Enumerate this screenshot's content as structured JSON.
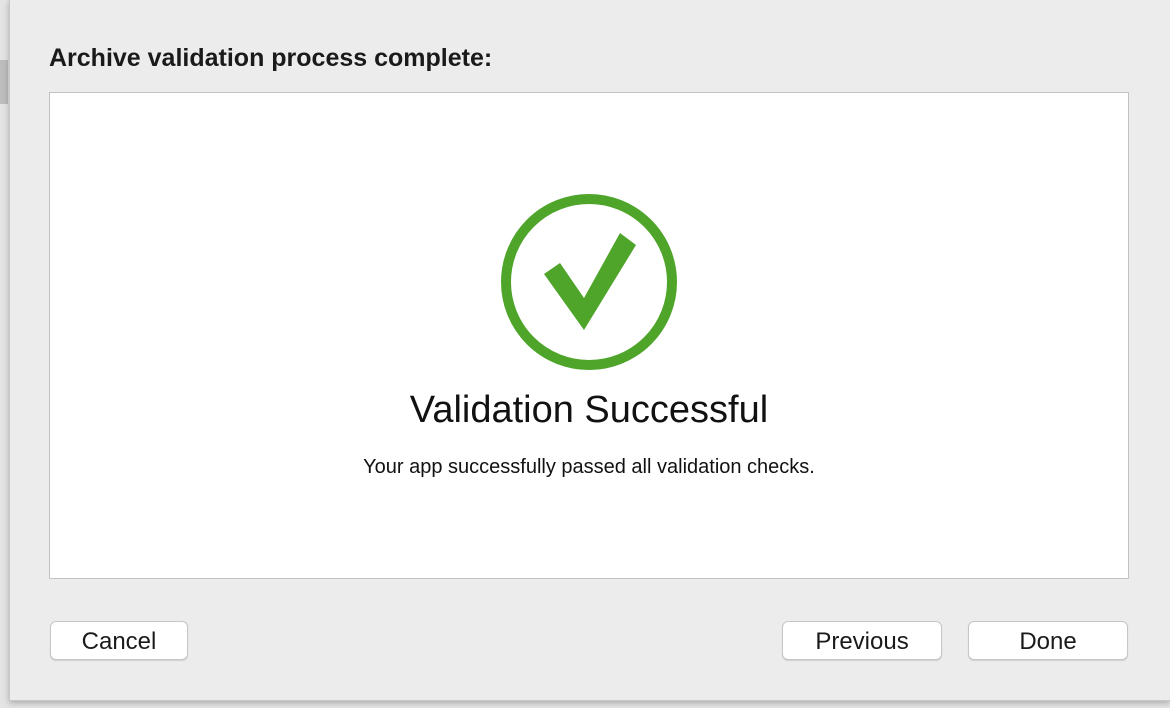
{
  "dialog": {
    "title": "Archive validation process complete:"
  },
  "result": {
    "status": "success",
    "icon": "checkmark-circle-icon",
    "icon_color": "#4ea52a",
    "title": "Validation Successful",
    "message": "Your app successfully passed all validation checks."
  },
  "buttons": {
    "cancel_label": "Cancel",
    "previous_label": "Previous",
    "done_label": "Done"
  }
}
